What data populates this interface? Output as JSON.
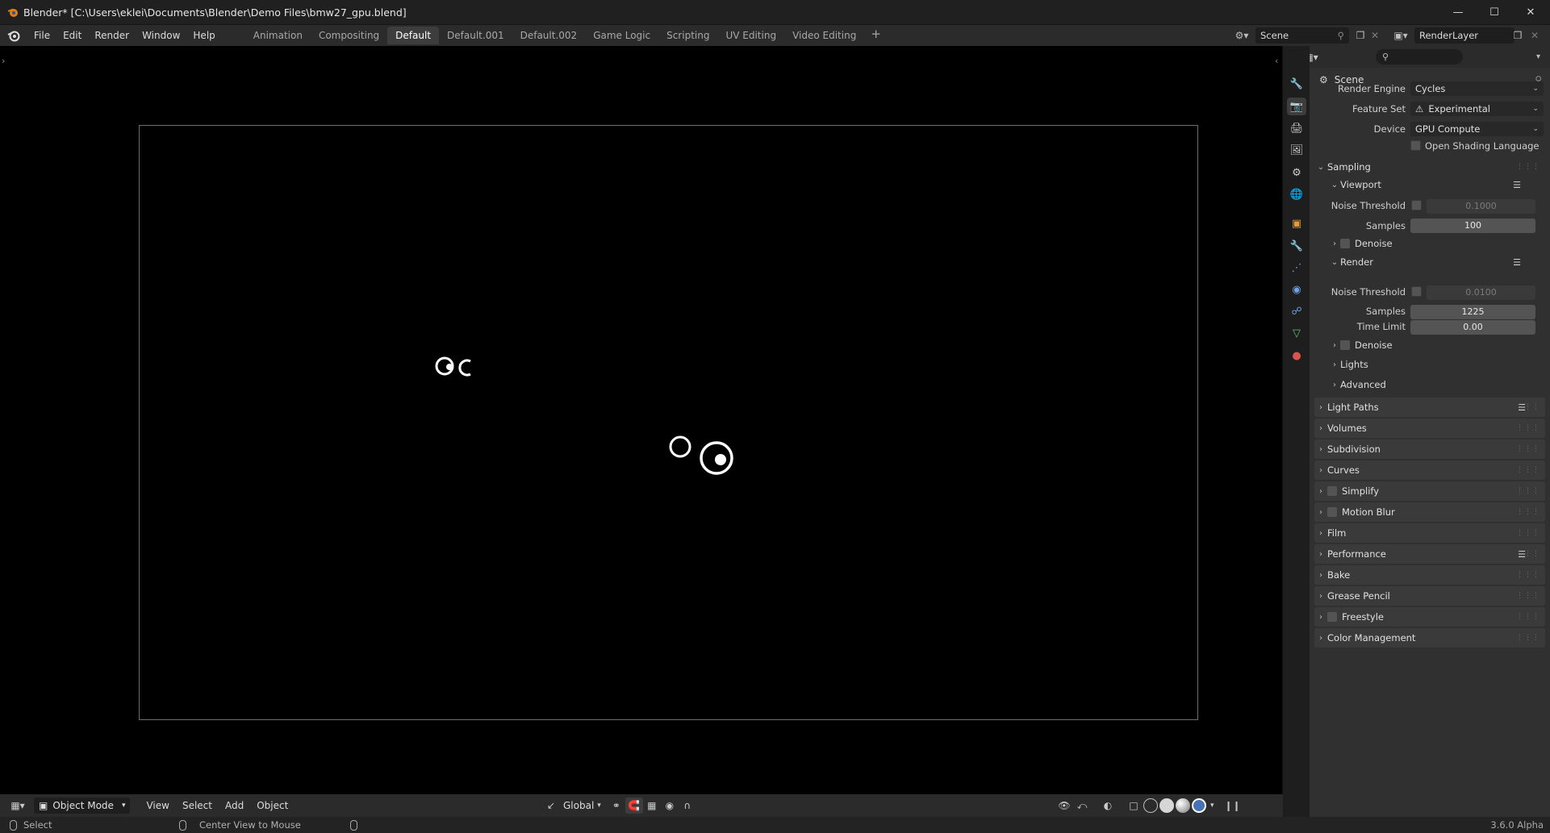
{
  "window": {
    "title": "Blender* [C:\\Users\\eklei\\Documents\\Blender\\Demo Files\\bmw27_gpu.blend]",
    "minimize_icon": "minimize-icon",
    "maximize_icon": "maximize-icon",
    "close_icon": "close-icon"
  },
  "menu": {
    "items": [
      "File",
      "Edit",
      "Render",
      "Window",
      "Help"
    ]
  },
  "workspaces": {
    "tabs": [
      "Animation",
      "Compositing",
      "Default",
      "Default.001",
      "Default.002",
      "Game Logic",
      "Scripting",
      "UV Editing",
      "Video Editing"
    ],
    "active": "Default",
    "add_label": "+"
  },
  "scene_selector": {
    "value": "Scene"
  },
  "layer_selector": {
    "value": "RenderLayer"
  },
  "viewport_header": {
    "mode": "Object Mode",
    "menus": [
      "View",
      "Select",
      "Add",
      "Object"
    ],
    "transform_orientation": "Global"
  },
  "statusbar": {
    "left_action": "Select",
    "middle_action": "Center View to Mouse",
    "version": "3.6.0 Alpha"
  },
  "properties": {
    "search_placeholder": "",
    "context_label": "Scene",
    "render_engine_label": "Render Engine",
    "render_engine": "Cycles",
    "feature_set_label": "Feature Set",
    "feature_set": "Experimental",
    "device_label": "Device",
    "device": "GPU Compute",
    "osl_label": "Open Shading Language",
    "sampling": {
      "label": "Sampling",
      "viewport": {
        "label": "Viewport",
        "noise_threshold_label": "Noise Threshold",
        "noise_threshold": "0.1000",
        "samples_label": "Samples",
        "samples": "100",
        "denoise_label": "Denoise"
      },
      "render": {
        "label": "Render",
        "noise_threshold_label": "Noise Threshold",
        "noise_threshold": "0.0100",
        "samples_label": "Samples",
        "samples": "1225",
        "time_limit_label": "Time Limit",
        "time_limit": "0.00",
        "denoise_label": "Denoise"
      },
      "lights_label": "Lights",
      "advanced_label": "Advanced"
    },
    "panels": [
      "Light Paths",
      "Volumes",
      "Subdivision",
      "Curves",
      "Simplify",
      "Motion Blur",
      "Film",
      "Performance",
      "Bake",
      "Grease Pencil",
      "Freestyle",
      "Color Management"
    ]
  },
  "colors": {
    "accent_blue": "#4772b3",
    "orange_icon": "#e69a3c",
    "bg_dark": "#1d1d1d",
    "panel_bg": "#303030"
  }
}
